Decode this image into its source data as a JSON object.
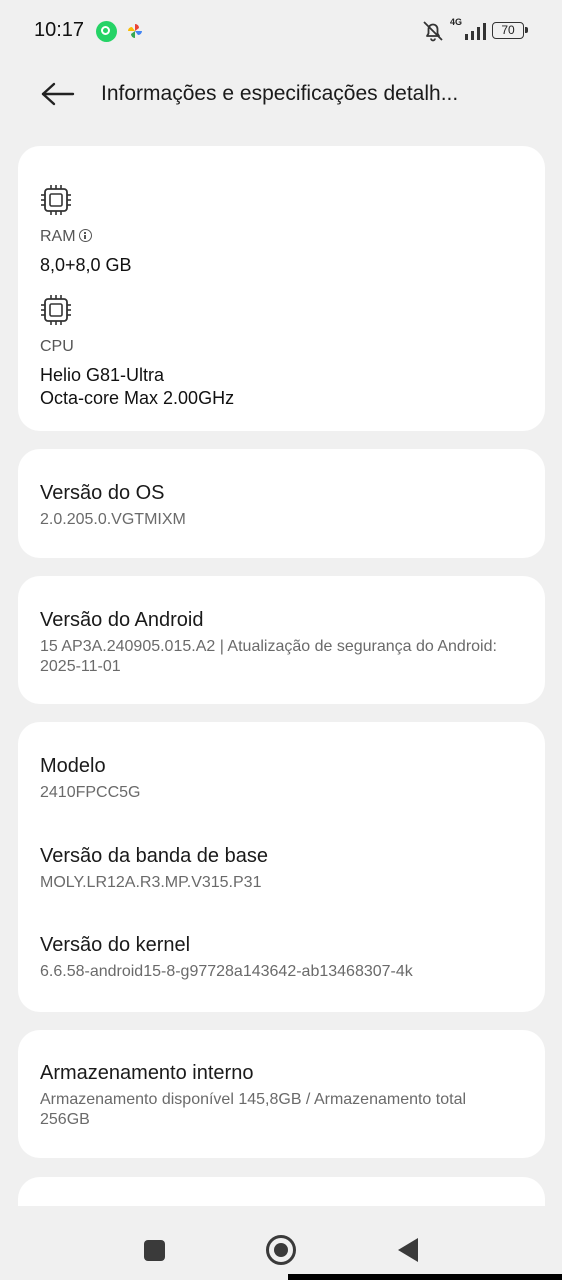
{
  "status_bar": {
    "time": "10:17",
    "network": "4G",
    "battery": "70",
    "icons": [
      "whatsapp-icon",
      "pinwheel-icon",
      "bell-off-icon",
      "signal-icon",
      "battery-icon"
    ]
  },
  "header": {
    "title": "Informações e especificações detalh...",
    "back_icon": "arrow-left-icon"
  },
  "specs": {
    "ram": {
      "label": "RAM",
      "value": "8,0+8,0 GB",
      "icon": "chip-icon"
    },
    "cpu": {
      "label": "CPU",
      "value_line1": "Helio G81-Ultra",
      "value_line2": "Octa-core Max 2.00GHz",
      "icon": "chip-icon"
    }
  },
  "os": {
    "title": "Versão do OS",
    "value": "2.0.205.0.VGTMIXM"
  },
  "android": {
    "title": "Versão do Android",
    "value": "15 AP3A.240905.015.A2 | Atualização de segurança do Android: 2025-11-01"
  },
  "device": {
    "model_title": "Modelo",
    "model_value": "2410FPCC5G",
    "baseband_title": "Versão da banda de base",
    "baseband_value": "MOLY.LR12A.R3.MP.V315.P31",
    "kernel_title": "Versão do kernel",
    "kernel_value": "6.6.58-android15-8-g97728a143642-ab13468307-4k"
  },
  "storage": {
    "title": "Armazenamento interno",
    "value": "Armazenamento disponível  145,8GB / Armazenamento total 256GB"
  },
  "nav_bar": {
    "icons": [
      "recents-icon",
      "home-icon",
      "back-icon"
    ]
  },
  "colors": {
    "background": "#f0f0f0",
    "card": "#ffffff",
    "text": "#1a1a1a",
    "subtext": "#6a6a6a"
  }
}
